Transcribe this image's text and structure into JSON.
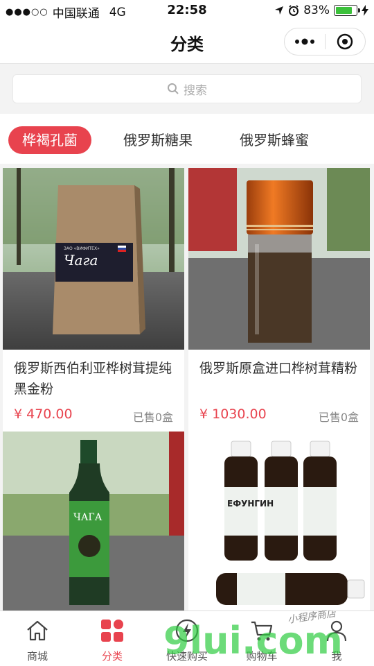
{
  "status_bar": {
    "signal_dots": "●●●○○",
    "carrier": "中国联通",
    "network": "4G",
    "time": "22:58",
    "battery": "83%",
    "battery_level": 0.83
  },
  "nav": {
    "title": "分类"
  },
  "search": {
    "placeholder": "搜索"
  },
  "tabs": [
    {
      "label": "桦褐孔菌",
      "active": true
    },
    {
      "label": "俄罗斯糖果",
      "active": false
    },
    {
      "label": "俄罗斯蜂蜜",
      "active": false
    }
  ],
  "products": [
    {
      "name": "俄罗斯西伯利亚桦树茸提纯黑金粉",
      "price": "¥ 470.00",
      "sold": "已售0盒",
      "package_label": "Чага",
      "package_sub": "ЗАО «ВИФИТЕХ»"
    },
    {
      "name": "俄罗斯原盒进口桦树茸精粉",
      "price": "¥ 1030.00",
      "sold": "已售0盒"
    },
    {
      "name": "",
      "price": "",
      "sold": "",
      "package_label": "ЧАГА"
    },
    {
      "name": "",
      "price": "",
      "sold": "",
      "package_label": "ЕФУНГИН"
    }
  ],
  "tab_bar": [
    {
      "label": "商城",
      "icon": "home-icon",
      "active": false
    },
    {
      "label": "分类",
      "icon": "category-grid-icon",
      "active": true
    },
    {
      "label": "快速购买",
      "icon": "lightning-icon",
      "active": false
    },
    {
      "label": "购物车",
      "icon": "cart-icon",
      "active": false
    },
    {
      "label": "我",
      "icon": "user-icon",
      "active": false
    }
  ],
  "watermark": {
    "text": "9lui.com",
    "tagline": "小程序商店"
  },
  "colors": {
    "accent": "#e8434e",
    "background": "#f3f3f3"
  }
}
